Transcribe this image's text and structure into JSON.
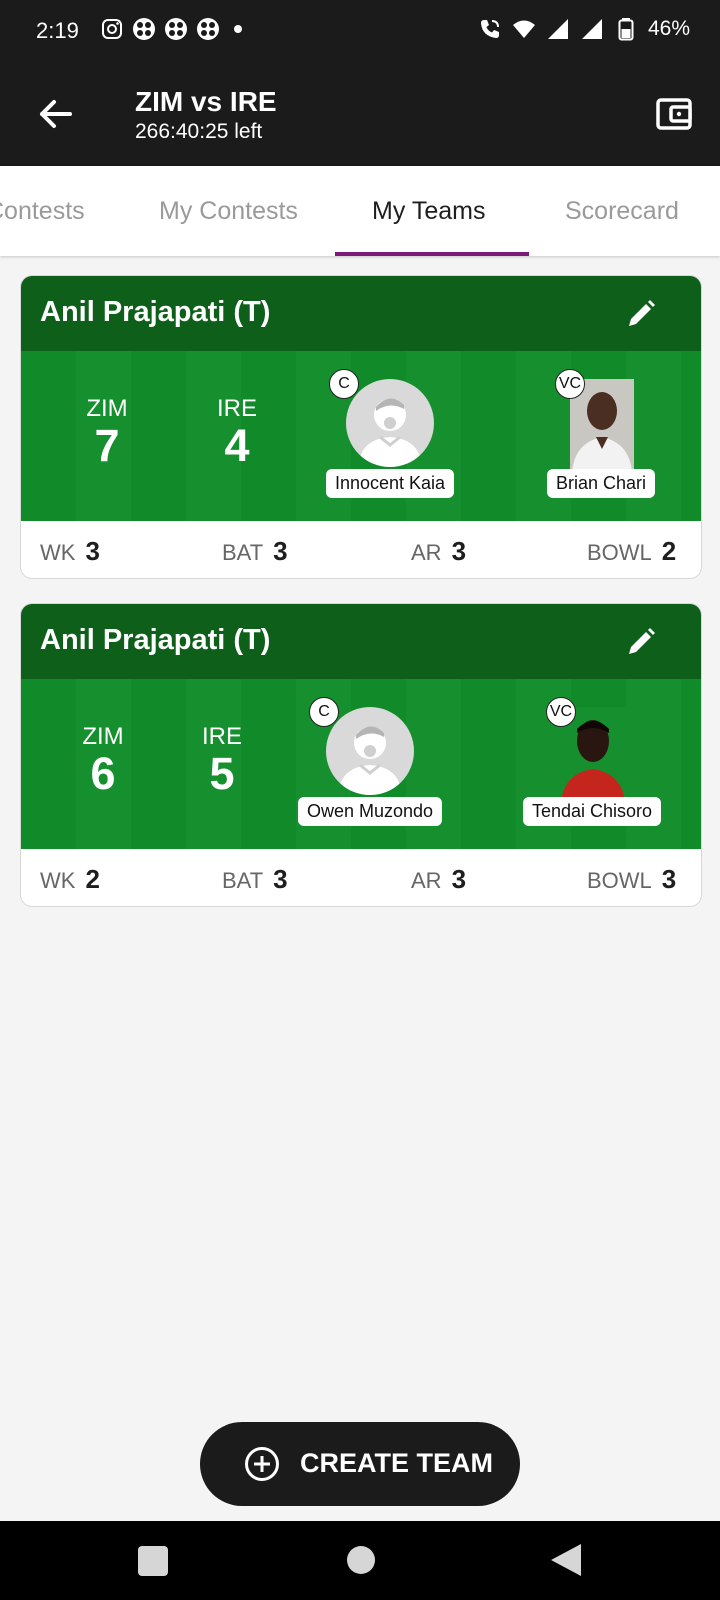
{
  "status_bar": {
    "time": "2:19",
    "battery": "46%"
  },
  "header": {
    "title": "ZIM vs IRE",
    "subtitle": "266:40:25 left"
  },
  "tabs": [
    {
      "label": "Contests"
    },
    {
      "label": "My Contests"
    },
    {
      "label": "My Teams",
      "active": true
    },
    {
      "label": "Scorecard"
    }
  ],
  "teams": [
    {
      "name": "Anil Prajapati (T)",
      "team1": {
        "code": "ZIM",
        "count": "7"
      },
      "team2": {
        "code": "IRE",
        "count": "4"
      },
      "captain": {
        "badge": "C",
        "name": "Innocent Kaia"
      },
      "vice_captain": {
        "badge": "VC",
        "name": "Brian Chari"
      },
      "stats": [
        {
          "label": "WK",
          "value": "3"
        },
        {
          "label": "BAT",
          "value": "3"
        },
        {
          "label": "AR",
          "value": "3"
        },
        {
          "label": "BOWL",
          "value": "2"
        }
      ]
    },
    {
      "name": "Anil Prajapati (T)",
      "team1": {
        "code": "ZIM",
        "count": "6"
      },
      "team2": {
        "code": "IRE",
        "count": "5"
      },
      "captain": {
        "badge": "C",
        "name": "Owen Muzondo"
      },
      "vice_captain": {
        "badge": "VC",
        "name": "Tendai Chisoro"
      },
      "stats": [
        {
          "label": "WK",
          "value": "2"
        },
        {
          "label": "BAT",
          "value": "3"
        },
        {
          "label": "AR",
          "value": "3"
        },
        {
          "label": "BOWL",
          "value": "3"
        }
      ]
    }
  ],
  "create_button": {
    "label": "CREATE TEAM"
  },
  "colors": {
    "header": "#1b1b1b",
    "accent": "#7b1b79",
    "card_header": "#0d5f1a",
    "field": "#118a2a"
  }
}
